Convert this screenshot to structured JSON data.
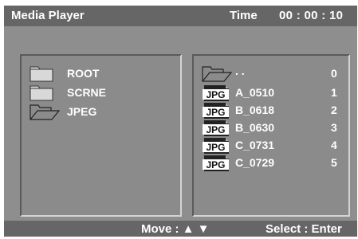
{
  "header": {
    "title": "Media Player",
    "time_label": "Time",
    "time_value": "00 : 00 : 10"
  },
  "folders": [
    {
      "label": "ROOT",
      "icon": "folder-closed-icon"
    },
    {
      "label": "SCRNE",
      "icon": "folder-closed-icon"
    },
    {
      "label": "JPEG",
      "icon": "folder-open-icon",
      "selected": true
    }
  ],
  "files": [
    {
      "label": ". .",
      "num": "0",
      "icon": "folder-open-icon"
    },
    {
      "label": "A_0510",
      "num": "1",
      "icon": "jpg-file-icon"
    },
    {
      "label": "B_0618",
      "num": "2",
      "icon": "jpg-file-icon"
    },
    {
      "label": "B_0630",
      "num": "3",
      "icon": "jpg-file-icon"
    },
    {
      "label": "C_0731",
      "num": "4",
      "icon": "jpg-file-icon"
    },
    {
      "label": "C_0729",
      "num": "5",
      "icon": "jpg-file-icon"
    }
  ],
  "jpg_icon_text": "JPG",
  "footer": {
    "move_label": "Move : ▲ ▼",
    "select_label": "Select : Enter"
  },
  "colors": {
    "background": "#8e8e8e",
    "title_bar": "#666666",
    "text": "#ffffff"
  }
}
